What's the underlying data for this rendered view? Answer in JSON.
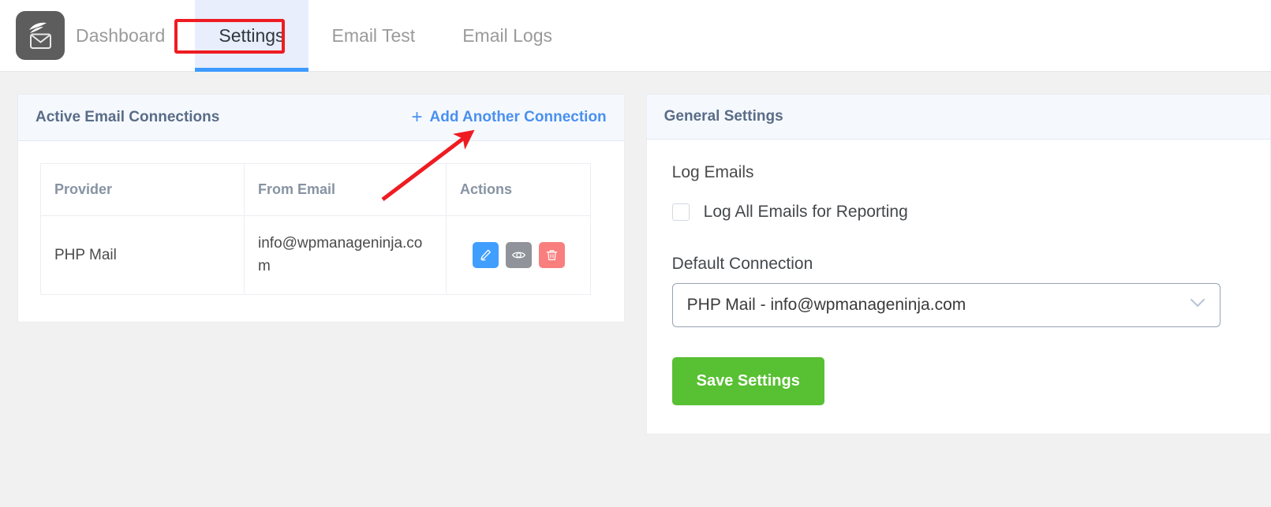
{
  "nav": {
    "brand_label": "Dashboard",
    "logo_icon": "envelope-leaf-logo-icon",
    "tabs": [
      {
        "label": "Settings",
        "active": true
      },
      {
        "label": "Email Test",
        "active": false
      },
      {
        "label": "Email Logs",
        "active": false
      }
    ]
  },
  "annotations": {
    "tab_highlight_color": "#ee1c22",
    "arrow_color": "#ee1c22"
  },
  "connections_panel": {
    "title": "Active Email Connections",
    "add_link": "Add Another Connection",
    "add_icon": "plus-icon",
    "columns": [
      "Provider",
      "From Email",
      "Actions"
    ],
    "rows": [
      {
        "provider": "PHP Mail",
        "from_email": "info@wpmanageninja.com",
        "actions": [
          {
            "name": "edit-connection-button",
            "icon": "pencil-icon",
            "color": "#409eff"
          },
          {
            "name": "view-connection-button",
            "icon": "eye-icon",
            "color": "#909399"
          },
          {
            "name": "delete-connection-button",
            "icon": "trash-icon",
            "color": "#f97f7f"
          }
        ]
      }
    ]
  },
  "general_settings": {
    "title": "General Settings",
    "log_emails_label": "Log Emails",
    "log_all_checkbox_label": "Log All Emails for Reporting",
    "log_all_checked": false,
    "default_connection_label": "Default Connection",
    "default_connection_value": "PHP Mail - info@wpmanageninja.com",
    "dropdown_icon": "chevron-down-icon",
    "save_button": "Save Settings",
    "save_button_color": "#58c033"
  }
}
